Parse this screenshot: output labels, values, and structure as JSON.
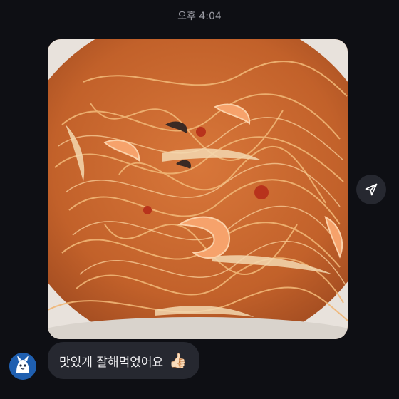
{
  "chat": {
    "timestamp": "오후 4:04",
    "message_text": "맛있게 잘해먹었어요",
    "message_emoji": "👍🏻"
  },
  "icons": {
    "share": "send-icon",
    "avatar": "avatar-mascot"
  },
  "colors": {
    "background": "#0e0f14",
    "bubble": "#262830",
    "timestamp_text": "#9a9ba3",
    "message_text": "#f2f2f4"
  }
}
